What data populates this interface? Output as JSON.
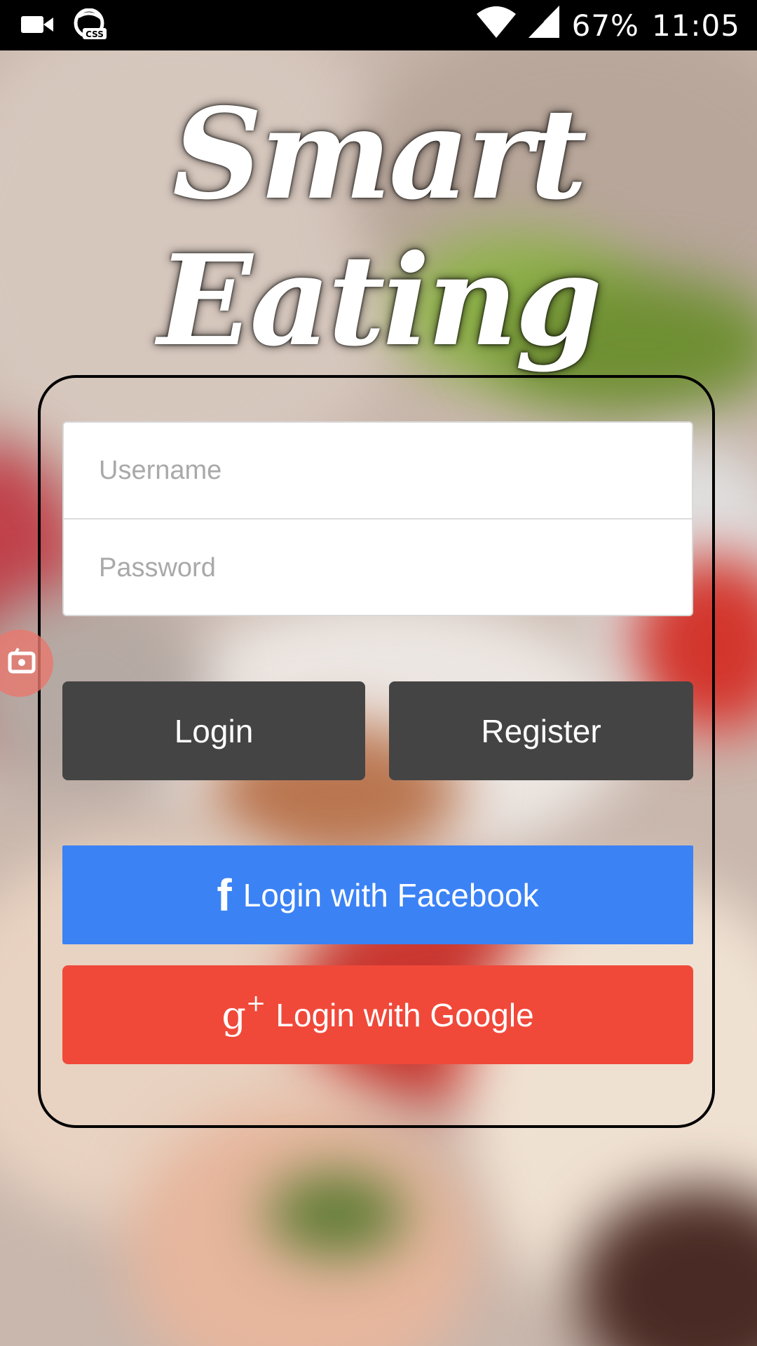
{
  "status_bar": {
    "battery": "67%",
    "time": "11:05",
    "icons": [
      "video-camera-icon",
      "css-app-icon",
      "wifi-icon",
      "cell-signal-icon"
    ]
  },
  "app": {
    "logo_text": "Smart Eating"
  },
  "login_form": {
    "username_placeholder": "Username",
    "password_placeholder": "Password",
    "login_label": "Login",
    "register_label": "Register",
    "facebook_label": "Login with Facebook",
    "google_label": "Login with Google",
    "facebook_icon": "f",
    "google_icon": "g"
  },
  "colors": {
    "status_bar": "#000000",
    "dark_button": "#444444",
    "facebook": "#3b82f5",
    "google": "#f0493a"
  }
}
